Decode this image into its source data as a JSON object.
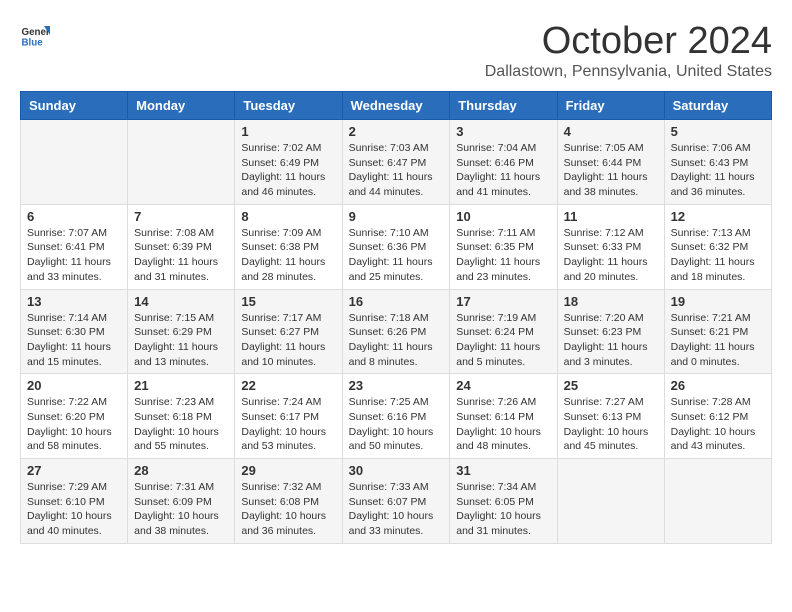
{
  "header": {
    "logo": {
      "general": "General",
      "blue": "Blue"
    },
    "title": "October 2024",
    "location": "Dallastown, Pennsylvania, United States"
  },
  "weekdays": [
    "Sunday",
    "Monday",
    "Tuesday",
    "Wednesday",
    "Thursday",
    "Friday",
    "Saturday"
  ],
  "weeks": [
    [
      {
        "day": "",
        "info": ""
      },
      {
        "day": "",
        "info": ""
      },
      {
        "day": "1",
        "info": "Sunrise: 7:02 AM\nSunset: 6:49 PM\nDaylight: 11 hours and 46 minutes."
      },
      {
        "day": "2",
        "info": "Sunrise: 7:03 AM\nSunset: 6:47 PM\nDaylight: 11 hours and 44 minutes."
      },
      {
        "day": "3",
        "info": "Sunrise: 7:04 AM\nSunset: 6:46 PM\nDaylight: 11 hours and 41 minutes."
      },
      {
        "day": "4",
        "info": "Sunrise: 7:05 AM\nSunset: 6:44 PM\nDaylight: 11 hours and 38 minutes."
      },
      {
        "day": "5",
        "info": "Sunrise: 7:06 AM\nSunset: 6:43 PM\nDaylight: 11 hours and 36 minutes."
      }
    ],
    [
      {
        "day": "6",
        "info": "Sunrise: 7:07 AM\nSunset: 6:41 PM\nDaylight: 11 hours and 33 minutes."
      },
      {
        "day": "7",
        "info": "Sunrise: 7:08 AM\nSunset: 6:39 PM\nDaylight: 11 hours and 31 minutes."
      },
      {
        "day": "8",
        "info": "Sunrise: 7:09 AM\nSunset: 6:38 PM\nDaylight: 11 hours and 28 minutes."
      },
      {
        "day": "9",
        "info": "Sunrise: 7:10 AM\nSunset: 6:36 PM\nDaylight: 11 hours and 25 minutes."
      },
      {
        "day": "10",
        "info": "Sunrise: 7:11 AM\nSunset: 6:35 PM\nDaylight: 11 hours and 23 minutes."
      },
      {
        "day": "11",
        "info": "Sunrise: 7:12 AM\nSunset: 6:33 PM\nDaylight: 11 hours and 20 minutes."
      },
      {
        "day": "12",
        "info": "Sunrise: 7:13 AM\nSunset: 6:32 PM\nDaylight: 11 hours and 18 minutes."
      }
    ],
    [
      {
        "day": "13",
        "info": "Sunrise: 7:14 AM\nSunset: 6:30 PM\nDaylight: 11 hours and 15 minutes."
      },
      {
        "day": "14",
        "info": "Sunrise: 7:15 AM\nSunset: 6:29 PM\nDaylight: 11 hours and 13 minutes."
      },
      {
        "day": "15",
        "info": "Sunrise: 7:17 AM\nSunset: 6:27 PM\nDaylight: 11 hours and 10 minutes."
      },
      {
        "day": "16",
        "info": "Sunrise: 7:18 AM\nSunset: 6:26 PM\nDaylight: 11 hours and 8 minutes."
      },
      {
        "day": "17",
        "info": "Sunrise: 7:19 AM\nSunset: 6:24 PM\nDaylight: 11 hours and 5 minutes."
      },
      {
        "day": "18",
        "info": "Sunrise: 7:20 AM\nSunset: 6:23 PM\nDaylight: 11 hours and 3 minutes."
      },
      {
        "day": "19",
        "info": "Sunrise: 7:21 AM\nSunset: 6:21 PM\nDaylight: 11 hours and 0 minutes."
      }
    ],
    [
      {
        "day": "20",
        "info": "Sunrise: 7:22 AM\nSunset: 6:20 PM\nDaylight: 10 hours and 58 minutes."
      },
      {
        "day": "21",
        "info": "Sunrise: 7:23 AM\nSunset: 6:18 PM\nDaylight: 10 hours and 55 minutes."
      },
      {
        "day": "22",
        "info": "Sunrise: 7:24 AM\nSunset: 6:17 PM\nDaylight: 10 hours and 53 minutes."
      },
      {
        "day": "23",
        "info": "Sunrise: 7:25 AM\nSunset: 6:16 PM\nDaylight: 10 hours and 50 minutes."
      },
      {
        "day": "24",
        "info": "Sunrise: 7:26 AM\nSunset: 6:14 PM\nDaylight: 10 hours and 48 minutes."
      },
      {
        "day": "25",
        "info": "Sunrise: 7:27 AM\nSunset: 6:13 PM\nDaylight: 10 hours and 45 minutes."
      },
      {
        "day": "26",
        "info": "Sunrise: 7:28 AM\nSunset: 6:12 PM\nDaylight: 10 hours and 43 minutes."
      }
    ],
    [
      {
        "day": "27",
        "info": "Sunrise: 7:29 AM\nSunset: 6:10 PM\nDaylight: 10 hours and 40 minutes."
      },
      {
        "day": "28",
        "info": "Sunrise: 7:31 AM\nSunset: 6:09 PM\nDaylight: 10 hours and 38 minutes."
      },
      {
        "day": "29",
        "info": "Sunrise: 7:32 AM\nSunset: 6:08 PM\nDaylight: 10 hours and 36 minutes."
      },
      {
        "day": "30",
        "info": "Sunrise: 7:33 AM\nSunset: 6:07 PM\nDaylight: 10 hours and 33 minutes."
      },
      {
        "day": "31",
        "info": "Sunrise: 7:34 AM\nSunset: 6:05 PM\nDaylight: 10 hours and 31 minutes."
      },
      {
        "day": "",
        "info": ""
      },
      {
        "day": "",
        "info": ""
      }
    ]
  ]
}
